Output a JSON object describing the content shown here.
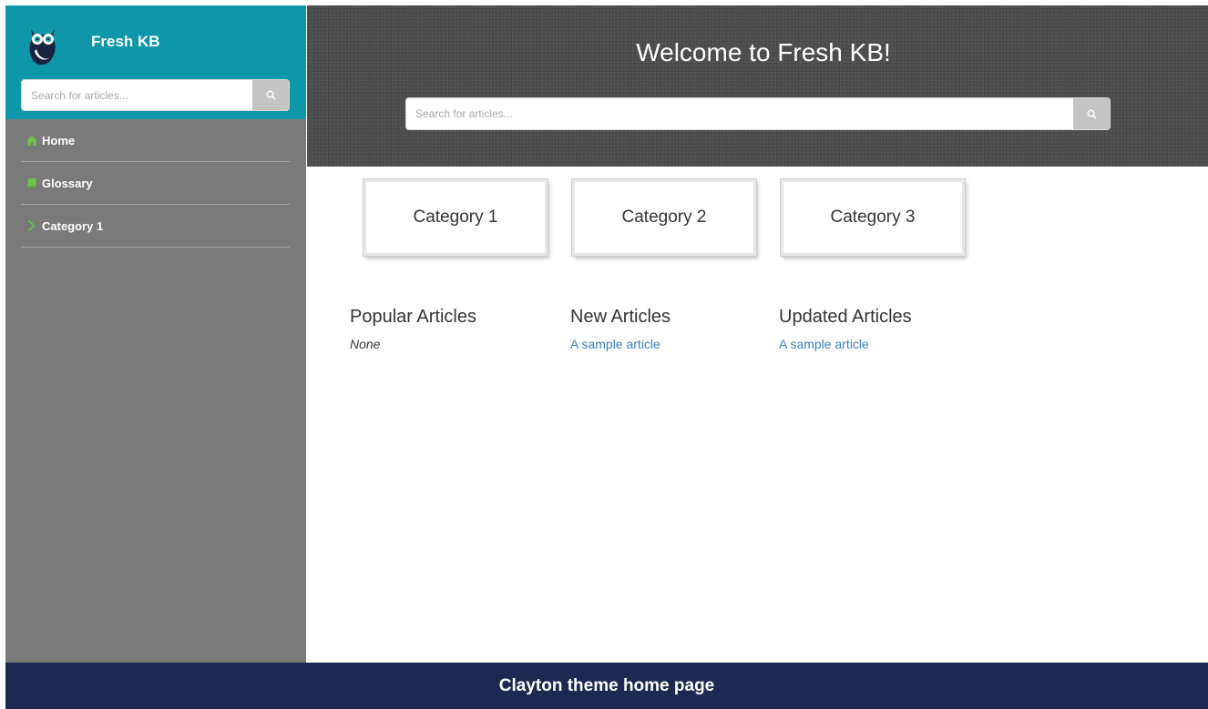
{
  "sidebar": {
    "brand": "Fresh KB",
    "search_placeholder": "Search for articles...",
    "nav_items": [
      {
        "label": "Home",
        "icon": "home-icon"
      },
      {
        "label": "Glossary",
        "icon": "book-icon"
      },
      {
        "label": "Category 1",
        "icon": "chevron-right-icon"
      }
    ]
  },
  "header": {
    "welcome": "Welcome to Fresh KB!",
    "search_placeholder": "Search for articles..."
  },
  "categories": [
    "Category 1",
    "Category 2",
    "Category 3"
  ],
  "articles": {
    "popular": {
      "title": "Popular Articles",
      "empty_text": "None"
    },
    "new": {
      "title": "New Articles",
      "link": "A sample article"
    },
    "updated": {
      "title": "Updated Articles",
      "link": "A sample article"
    }
  },
  "footer": {
    "caption": "Clayton theme home page"
  },
  "colors": {
    "sidebar_top": "#0e97a8",
    "sidebar_bg": "#7a7a7a",
    "accent_icon": "#6cc24a",
    "link": "#3a7fc1",
    "footer": "#1c2a52"
  }
}
